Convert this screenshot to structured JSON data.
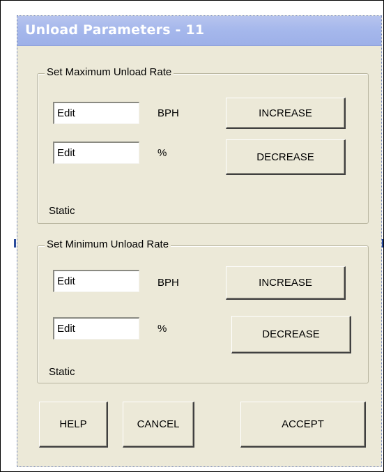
{
  "dialog": {
    "title": "Unload Parameters - 11"
  },
  "max_group": {
    "label": "Set Maximum Unload Rate",
    "bph_value": "Edit",
    "bph_unit": "BPH",
    "pct_value": "Edit",
    "pct_unit": "%",
    "increase_label": "INCREASE",
    "decrease_label": "DECREASE",
    "static_text": "Static"
  },
  "min_group": {
    "label": "Set Minimum Unload Rate",
    "bph_value": "Edit",
    "bph_unit": "BPH",
    "pct_value": "Edit",
    "pct_unit": "%",
    "increase_label": "INCREASE",
    "decrease_label": "DECREASE",
    "static_text": "Static"
  },
  "footer": {
    "help_label": "HELP",
    "cancel_label": "CANCEL",
    "accept_label": "ACCEPT"
  }
}
